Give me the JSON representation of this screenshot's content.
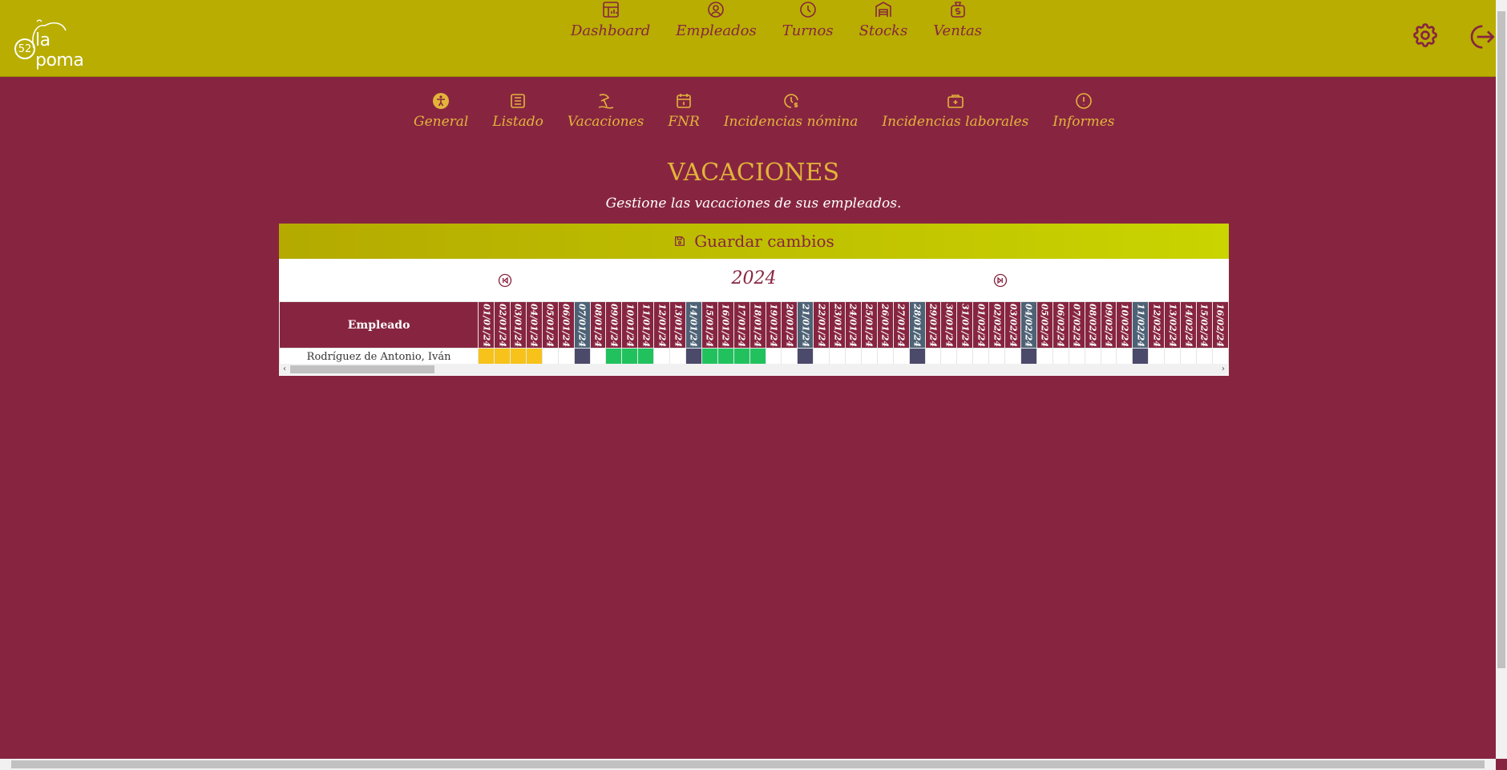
{
  "app": {
    "logo_badge": "52",
    "logo_text": "la poma"
  },
  "main_nav": [
    {
      "label": "Dashboard",
      "icon": "dashboard-icon"
    },
    {
      "label": "Empleados",
      "icon": "user-circle-icon"
    },
    {
      "label": "Turnos",
      "icon": "clock-icon"
    },
    {
      "label": "Stocks",
      "icon": "warehouse-icon"
    },
    {
      "label": "Ventas",
      "icon": "money-bag-icon"
    }
  ],
  "sub_nav": [
    {
      "label": "General",
      "icon": "accessibility-icon"
    },
    {
      "label": "Listado",
      "icon": "list-icon"
    },
    {
      "label": "Vacaciones",
      "icon": "beach-icon"
    },
    {
      "label": "FNR",
      "icon": "calendar-icon"
    },
    {
      "label": "Incidencias nómina",
      "icon": "clock-dollar-icon"
    },
    {
      "label": "Incidencias laborales",
      "icon": "briefcase-plus-icon"
    },
    {
      "label": "Informes",
      "icon": "alert-circle-icon"
    }
  ],
  "page": {
    "title": "VACACIONES",
    "subtitle": "Gestione las vacaciones de sus empleados."
  },
  "panel": {
    "save_label": "Guardar cambios",
    "year": "2024",
    "employee_header": "Empleado",
    "days": [
      {
        "d": "01/01/24",
        "wk": false
      },
      {
        "d": "02/01/24",
        "wk": false
      },
      {
        "d": "03/01/24",
        "wk": false
      },
      {
        "d": "04/01/24",
        "wk": false
      },
      {
        "d": "05/01/24",
        "wk": false
      },
      {
        "d": "06/01/24",
        "wk": false
      },
      {
        "d": "07/01/24",
        "wk": true
      },
      {
        "d": "08/01/24",
        "wk": false
      },
      {
        "d": "09/01/24",
        "wk": false
      },
      {
        "d": "10/01/24",
        "wk": false
      },
      {
        "d": "11/01/24",
        "wk": false
      },
      {
        "d": "12/01/24",
        "wk": false
      },
      {
        "d": "13/01/24",
        "wk": false
      },
      {
        "d": "14/01/24",
        "wk": true
      },
      {
        "d": "15/01/24",
        "wk": false
      },
      {
        "d": "16/01/24",
        "wk": false
      },
      {
        "d": "17/01/24",
        "wk": false
      },
      {
        "d": "18/01/24",
        "wk": false
      },
      {
        "d": "19/01/24",
        "wk": false
      },
      {
        "d": "20/01/24",
        "wk": false
      },
      {
        "d": "21/01/24",
        "wk": true
      },
      {
        "d": "22/01/24",
        "wk": false
      },
      {
        "d": "23/01/24",
        "wk": false
      },
      {
        "d": "24/01/24",
        "wk": false
      },
      {
        "d": "25/01/24",
        "wk": false
      },
      {
        "d": "26/01/24",
        "wk": false
      },
      {
        "d": "27/01/24",
        "wk": false
      },
      {
        "d": "28/01/24",
        "wk": true
      },
      {
        "d": "29/01/24",
        "wk": false
      },
      {
        "d": "30/01/24",
        "wk": false
      },
      {
        "d": "31/01/24",
        "wk": false
      },
      {
        "d": "01/02/24",
        "wk": false
      },
      {
        "d": "02/02/24",
        "wk": false
      },
      {
        "d": "03/02/24",
        "wk": false
      },
      {
        "d": "04/02/24",
        "wk": true
      },
      {
        "d": "05/02/24",
        "wk": false
      },
      {
        "d": "06/02/24",
        "wk": false
      },
      {
        "d": "07/02/24",
        "wk": false
      },
      {
        "d": "08/02/24",
        "wk": false
      },
      {
        "d": "09/02/24",
        "wk": false
      },
      {
        "d": "10/02/24",
        "wk": false
      },
      {
        "d": "11/02/24",
        "wk": true
      },
      {
        "d": "12/02/24",
        "wk": false
      },
      {
        "d": "13/02/24",
        "wk": false
      },
      {
        "d": "14/02/24",
        "wk": false
      },
      {
        "d": "15/02/24",
        "wk": false
      },
      {
        "d": "16/02/24",
        "wk": false
      }
    ],
    "employees": [
      {
        "name": "Rodríguez de Antonio, Iván",
        "cells": [
          "y",
          "y",
          "y",
          "y",
          "",
          "",
          "s",
          "",
          "g",
          "g",
          "g",
          "",
          "",
          "s",
          "g",
          "g",
          "g",
          "g",
          "",
          "",
          "s",
          "",
          "",
          "",
          "",
          "",
          "",
          "s",
          "",
          "",
          "",
          "",
          "",
          "",
          "s",
          "",
          "",
          "",
          "",
          "",
          "",
          "s",
          "",
          "",
          "",
          "",
          ""
        ]
      }
    ]
  },
  "colors": {
    "y": "#f7c21a",
    "g": "#21c25e",
    "s": "#4b4a6b",
    "": "#ffffff"
  }
}
